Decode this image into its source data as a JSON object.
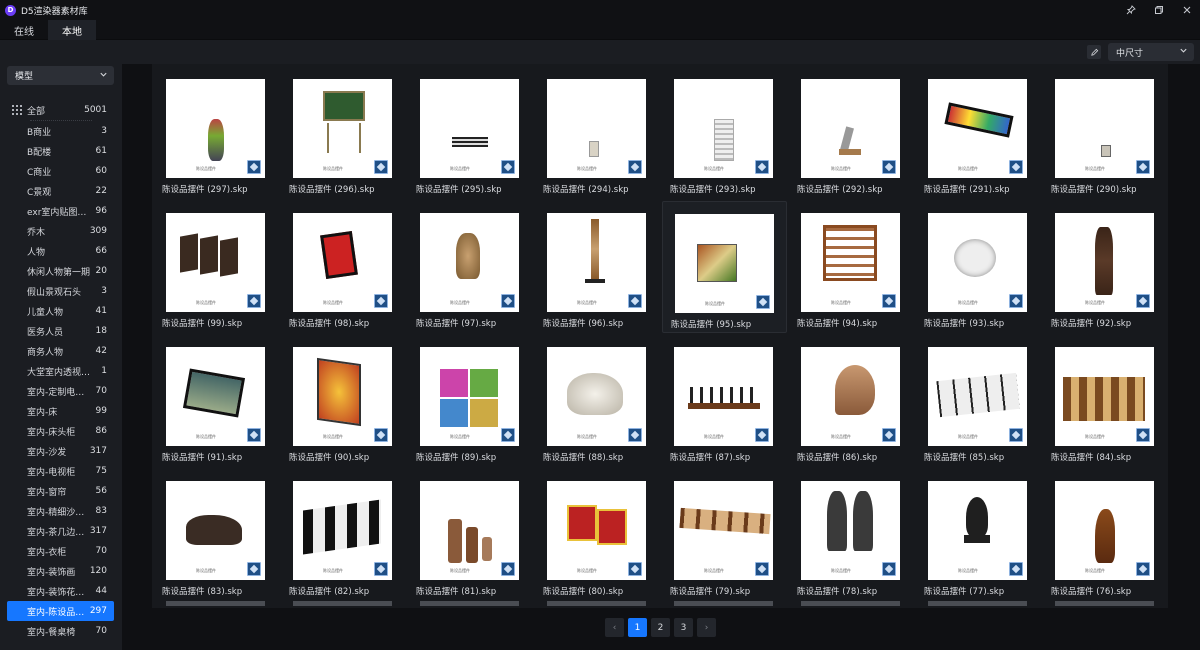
{
  "app": {
    "title": "D5渲染器素材库",
    "logo_letter": "D"
  },
  "tabs": [
    {
      "label": "在线"
    },
    {
      "label": "本地"
    }
  ],
  "toolbar": {
    "size_select": "中尺寸"
  },
  "sidebar": {
    "category_select": "模型",
    "all": {
      "label": "全部",
      "count": "5001"
    },
    "items": [
      {
        "label": "B商业",
        "count": "3"
      },
      {
        "label": "B配楼",
        "count": "61"
      },
      {
        "label": "C商业",
        "count": "60"
      },
      {
        "label": "C景观",
        "count": "22"
      },
      {
        "label": "exr室内贴图盒子...",
        "count": "96"
      },
      {
        "label": "乔木",
        "count": "309"
      },
      {
        "label": "人物",
        "count": "66"
      },
      {
        "label": "休闲人物第一期",
        "count": "20"
      },
      {
        "label": "假山景观石头",
        "count": "3"
      },
      {
        "label": "儿童人物",
        "count": "41"
      },
      {
        "label": "医务人员",
        "count": "18"
      },
      {
        "label": "商务人物",
        "count": "42"
      },
      {
        "label": "大堂室内透视盒子",
        "count": "1"
      },
      {
        "label": "室内-定制电视柜",
        "count": "70"
      },
      {
        "label": "室内-床",
        "count": "99"
      },
      {
        "label": "室内-床头柜",
        "count": "86"
      },
      {
        "label": "室内-沙发",
        "count": "317"
      },
      {
        "label": "室内-电视柜",
        "count": "75"
      },
      {
        "label": "室内-窗帘",
        "count": "56"
      },
      {
        "label": "室内-精细沙发组合",
        "count": "83"
      },
      {
        "label": "室内-茶几边机角几",
        "count": "317"
      },
      {
        "label": "室内-衣柜",
        "count": "70"
      },
      {
        "label": "室内-装饰画",
        "count": "120"
      },
      {
        "label": "室内-装饰花瓶摆件",
        "count": "44"
      },
      {
        "label": "室内-陈设品摆件",
        "count": "297"
      },
      {
        "label": "室内-餐桌椅",
        "count": "70"
      }
    ]
  },
  "grid": {
    "items": [
      "陈设品摆件 (297).skp",
      "陈设品摆件 (296).skp",
      "陈设品摆件 (295).skp",
      "陈设品摆件 (294).skp",
      "陈设品摆件 (293).skp",
      "陈设品摆件 (292).skp",
      "陈设品摆件 (291).skp",
      "陈设品摆件 (290).skp",
      "陈设品摆件 (99).skp",
      "陈设品摆件 (98).skp",
      "陈设品摆件 (97).skp",
      "陈设品摆件 (96).skp",
      "陈设品摆件 (95).skp",
      "陈设品摆件 (94).skp",
      "陈设品摆件 (93).skp",
      "陈设品摆件 (92).skp",
      "陈设品摆件 (91).skp",
      "陈设品摆件 (90).skp",
      "陈设品摆件 (89).skp",
      "陈设品摆件 (88).skp",
      "陈设品摆件 (87).skp",
      "陈设品摆件 (86).skp",
      "陈设品摆件 (85).skp",
      "陈设品摆件 (84).skp",
      "陈设品摆件 (83).skp",
      "陈设品摆件 (82).skp",
      "陈设品摆件 (81).skp",
      "陈设品摆件 (80).skp",
      "陈设品摆件 (79).skp",
      "陈设品摆件 (78).skp",
      "陈设品摆件 (77).skp",
      "陈设品摆件 (76).skp"
    ],
    "thumb_watermark": "陈设品摆件"
  },
  "pagination": {
    "prev": "‹",
    "pages": [
      "1",
      "2",
      "3"
    ],
    "next": "›"
  },
  "colors": {
    "accent": "#1677ff",
    "background": "#16181d"
  }
}
